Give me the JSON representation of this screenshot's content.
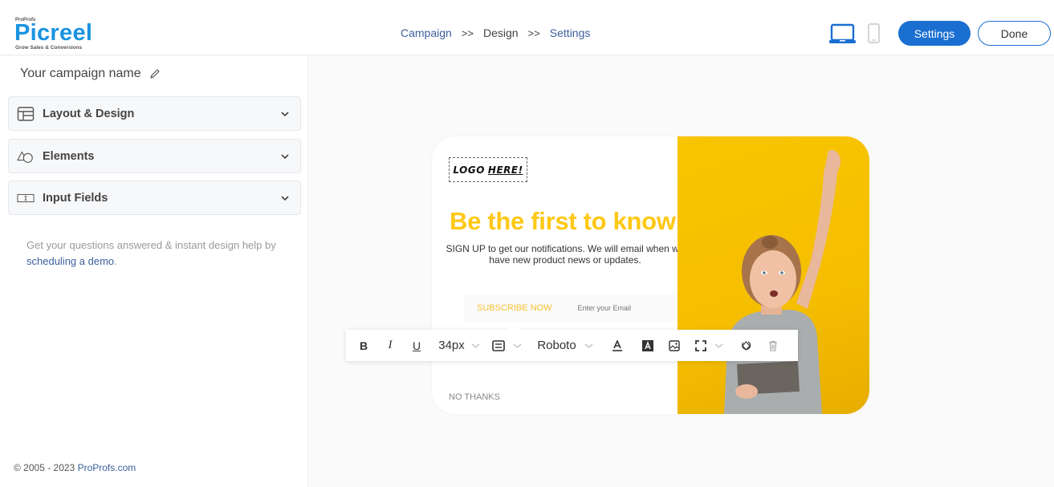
{
  "header": {
    "logo": {
      "brand_small": "ProProfs",
      "brand": "Picreel",
      "tagline": "Grow Sales & Conversions"
    },
    "breadcrumb": [
      {
        "label": "Campaign",
        "current": false
      },
      {
        "label": "Design",
        "current": true
      },
      {
        "label": "Settings",
        "current": false
      }
    ],
    "separator": ">>",
    "device_toggle": {
      "desktop_icon": "laptop-icon",
      "mobile_icon": "mobile-icon",
      "active": "desktop",
      "active_color": "#1a6fd1"
    },
    "settings_button": "Settings",
    "done_button": "Done"
  },
  "sidebar": {
    "campaign_name": "Your campaign name",
    "edit_icon": "pencil-icon",
    "sections": [
      {
        "label": "Layout & Design",
        "icon": "layout-icon"
      },
      {
        "label": "Elements",
        "icon": "shapes-icon"
      },
      {
        "label": "Input Fields",
        "icon": "input-field-icon"
      }
    ],
    "help_text": "Get your questions answered & instant design help by",
    "help_link": "scheduling a demo",
    "help_suffix": ".",
    "footer_text": "© 2005 - 2023",
    "footer_link": "ProProfs.com"
  },
  "popup": {
    "logo_placeholder_1": "LOGO",
    "logo_placeholder_2": "HERE!",
    "headline": "Be the first to know",
    "subtext": "SIGN UP to get our notifications. We will email when we have new product news or updates.",
    "subscribe_button": "SUBSCRIBE NOW",
    "email_placeholder": "Enter your Email",
    "no_thanks": "NO THANKS",
    "accent_color": "#ffc814",
    "hero_image": "woman-celebrating-with-tablet"
  },
  "toolbar": {
    "bold": "B",
    "italic": "I",
    "underline": "U",
    "font_size": "34px",
    "align_icon": "align-icon",
    "font_family": "Roboto",
    "text_color_icon": "text-color-icon",
    "bg_color_icon": "highlight-color-icon",
    "image_icon": "image-icon",
    "spacing_icon": "spacing-icon",
    "reset_icon": "reset-icon",
    "delete_icon": "trash-icon"
  }
}
